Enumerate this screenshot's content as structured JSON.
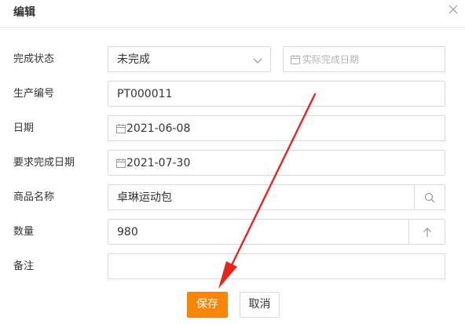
{
  "dialog": {
    "title": "编辑",
    "close_icon": "close-icon"
  },
  "form": {
    "status": {
      "label": "完成状态",
      "value": "未完成",
      "actual_date_placeholder": "实际完成日期"
    },
    "production_no": {
      "label": "生产编号",
      "value": "PT000011"
    },
    "date": {
      "label": "日期",
      "value": "2021-06-08"
    },
    "due_date": {
      "label": "要求完成日期",
      "value": "2021-07-30"
    },
    "product_name": {
      "label": "商品名称",
      "value": "卓琳运动包",
      "search_icon": "search-icon"
    },
    "quantity": {
      "label": "数量",
      "value": "980",
      "step_icon": "chevron-up-icon"
    },
    "remark": {
      "label": "备注",
      "value": ""
    }
  },
  "actions": {
    "save_label": "保存",
    "cancel_label": "取消"
  },
  "colors": {
    "accent": "#f5860b",
    "annotation_arrow": "#e8231e",
    "border": "#d9d9d9"
  }
}
